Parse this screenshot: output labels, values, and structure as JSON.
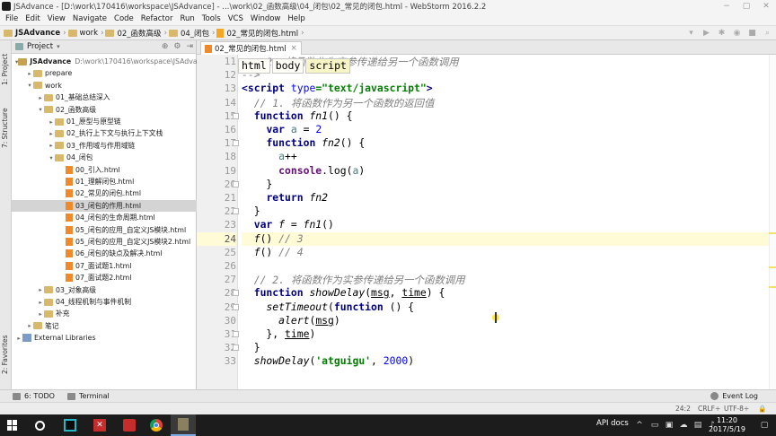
{
  "window": {
    "title": "JSAdvance - [D:\\work\\170416\\workspace\\JSAdvance] - ...\\work\\02_函数高级\\04_闭包\\02_常见的闭包.html - WebStorm 2016.2.2",
    "controls": [
      "−",
      "▢",
      "✕"
    ]
  },
  "menu": [
    "File",
    "Edit",
    "View",
    "Navigate",
    "Code",
    "Refactor",
    "Run",
    "Tools",
    "VCS",
    "Window",
    "Help"
  ],
  "breadcrumbs": [
    "JSAdvance",
    "work",
    "02_函数高级",
    "04_闭包",
    "02_常见的闭包.html"
  ],
  "left_strip": {
    "project": "1: Project",
    "structure": "7: Structure",
    "favorites": "2: Favorites"
  },
  "project_panel": {
    "title": "Project",
    "tree": [
      {
        "label": "JSAdvance",
        "note": "D:\\work\\170416\\workspace\\JSAdvance",
        "type": "folder",
        "depth": 1,
        "arrow": "▾"
      },
      {
        "label": "prepare",
        "type": "folder",
        "depth": 2,
        "arrow": "▸"
      },
      {
        "label": "work",
        "type": "folder",
        "depth": 2,
        "arrow": "▾"
      },
      {
        "label": "01_基础总结深入",
        "type": "folder",
        "depth": 3,
        "arrow": "▸"
      },
      {
        "label": "02_函数高级",
        "type": "folder",
        "depth": 3,
        "arrow": "▾"
      },
      {
        "label": "01_原型与原型链",
        "type": "folder",
        "depth": 4,
        "arrow": "▸"
      },
      {
        "label": "02_执行上下文与执行上下文栈",
        "type": "folder",
        "depth": 4,
        "arrow": "▸"
      },
      {
        "label": "03_作用域与作用域链",
        "type": "folder",
        "depth": 4,
        "arrow": "▸"
      },
      {
        "label": "04_闭包",
        "type": "folder",
        "depth": 4,
        "arrow": "▾"
      },
      {
        "label": "00_引入.html",
        "type": "html",
        "depth": 5
      },
      {
        "label": "01_理解闭包.html",
        "type": "html",
        "depth": 5
      },
      {
        "label": "02_常见的闭包.html",
        "type": "html",
        "depth": 5
      },
      {
        "label": "03_闭包的作用.html",
        "type": "html",
        "depth": 5,
        "selected": true
      },
      {
        "label": "04_闭包的生命周期.html",
        "type": "html",
        "depth": 5
      },
      {
        "label": "05_闭包的应用_自定义JS模块.html",
        "type": "html",
        "depth": 5
      },
      {
        "label": "05_闭包的应用_自定义JS模块2.html",
        "type": "html",
        "depth": 5
      },
      {
        "label": "06_闭包的缺点及解决.html",
        "type": "html",
        "depth": 5
      },
      {
        "label": "07_面试题1.html",
        "type": "html",
        "depth": 5
      },
      {
        "label": "07_面试题2.html",
        "type": "html",
        "depth": 5
      },
      {
        "label": "03_对象高级",
        "type": "folder",
        "depth": 3,
        "arrow": "▸"
      },
      {
        "label": "04_线程机制与事件机制",
        "type": "folder",
        "depth": 3,
        "arrow": "▸"
      },
      {
        "label": "补充",
        "type": "folder",
        "depth": 3,
        "arrow": "▸"
      },
      {
        "label": "笔记",
        "type": "folder",
        "depth": 2,
        "arrow": "▸"
      },
      {
        "label": "External Libraries",
        "type": "lib",
        "depth": 1,
        "arrow": "▸"
      }
    ]
  },
  "editor": {
    "tab": "02_常见的闭包.html",
    "context_crumbs": [
      "html",
      "body",
      "script"
    ],
    "line_numbers": [
      "11",
      "12",
      "13",
      "14",
      "15",
      "16",
      "17",
      "18",
      "19",
      "20",
      "21",
      "22",
      "23",
      "24",
      "25",
      "26",
      "27",
      "28",
      "29",
      "30",
      "31",
      "32",
      "33"
    ],
    "current_line": "24"
  },
  "bottom_tabs": {
    "todo": "6: TODO",
    "terminal": "Terminal",
    "event_log": "Event Log"
  },
  "status": {
    "position": "24:2",
    "line_sep": "CRLF÷",
    "encoding": "UTF-8÷"
  },
  "taskbar": {
    "api_docs": "API docs",
    "time": "11:20",
    "date": "2017/5/19"
  }
}
